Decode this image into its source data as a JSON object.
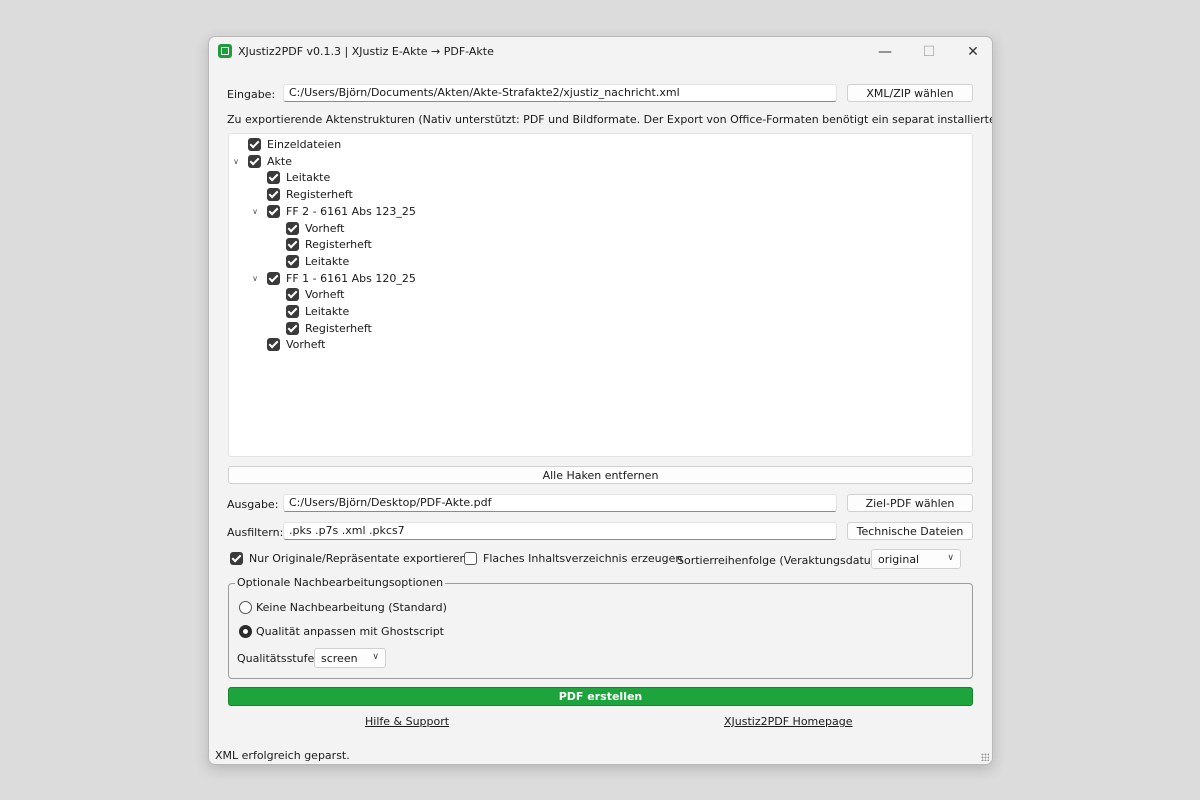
{
  "window": {
    "title": "XJustiz2PDF v0.1.3 | XJustiz E-Akte → PDF-Akte",
    "minimize": "—",
    "maximize": "☐",
    "close": "✕"
  },
  "input": {
    "label": "Eingabe:",
    "value": "C:/Users/Björn/Documents/Akten/Akte-Strafakte2/xjustiz_nachricht.xml",
    "button": "XML/ZIP wählen"
  },
  "structures": {
    "caption": "Zu exportierende Aktenstrukturen (Nativ unterstützt: PDF und Bildformate. Der Export von Office-Formaten benötigt ein separat installiertes LibreOffice.)",
    "tree": [
      {
        "label": "Einzeldateien",
        "level": 0,
        "expander": false,
        "checked": true
      },
      {
        "label": "Akte",
        "level": 0,
        "expander": true,
        "checked": true
      },
      {
        "label": "Leitakte",
        "level": 1,
        "expander": false,
        "checked": true
      },
      {
        "label": "Registerheft",
        "level": 1,
        "expander": false,
        "checked": true
      },
      {
        "label": "FF 2 - 6161 Abs 123_25",
        "level": 1,
        "expander": true,
        "checked": true
      },
      {
        "label": "Vorheft",
        "level": 2,
        "expander": false,
        "checked": true
      },
      {
        "label": "Registerheft",
        "level": 2,
        "expander": false,
        "checked": true
      },
      {
        "label": "Leitakte",
        "level": 2,
        "expander": false,
        "checked": true
      },
      {
        "label": "FF 1 - 6161 Abs 120_25",
        "level": 1,
        "expander": true,
        "checked": true
      },
      {
        "label": "Vorheft",
        "level": 2,
        "expander": false,
        "checked": true
      },
      {
        "label": "Leitakte",
        "level": 2,
        "expander": false,
        "checked": true
      },
      {
        "label": "Registerheft",
        "level": 2,
        "expander": false,
        "checked": true
      },
      {
        "label": "Vorheft",
        "level": 1,
        "expander": false,
        "checked": true
      }
    ],
    "clear_button": "Alle Haken entfernen"
  },
  "output": {
    "label": "Ausgabe:",
    "value": "C:/Users/Björn/Desktop/PDF-Akte.pdf",
    "button": "Ziel-PDF wählen"
  },
  "filter": {
    "label": "Ausfiltern:",
    "value": ".pks .p7s .xml .pkcs7",
    "button": "Technische Dateien"
  },
  "options": {
    "originals_label": "Nur Originale/Repräsentate exportieren",
    "originals_checked": true,
    "flat_label": "Flaches Inhaltsverzeichnis erzeugen",
    "flat_checked": false,
    "sort_label": "Sortierreihenfolge (Veraktungsdatum):",
    "sort_value": "original"
  },
  "postprocess": {
    "title": "Optionale Nachbearbeitungsoptionen",
    "none_label": "Keine Nachbearbeitung (Standard)",
    "ghostscript_label": "Qualität anpassen mit Ghostscript",
    "selected": "ghostscript",
    "quality_label": "Qualitätsstufe:",
    "quality_value": "screen"
  },
  "create_button": "PDF erstellen",
  "links": {
    "help": "Hilfe & Support",
    "homepage": "XJustiz2PDF Homepage"
  },
  "status": "XML erfolgreich geparst.",
  "colors": {
    "primary": "#1ea43c",
    "checkbox": "#3a3a3a"
  }
}
